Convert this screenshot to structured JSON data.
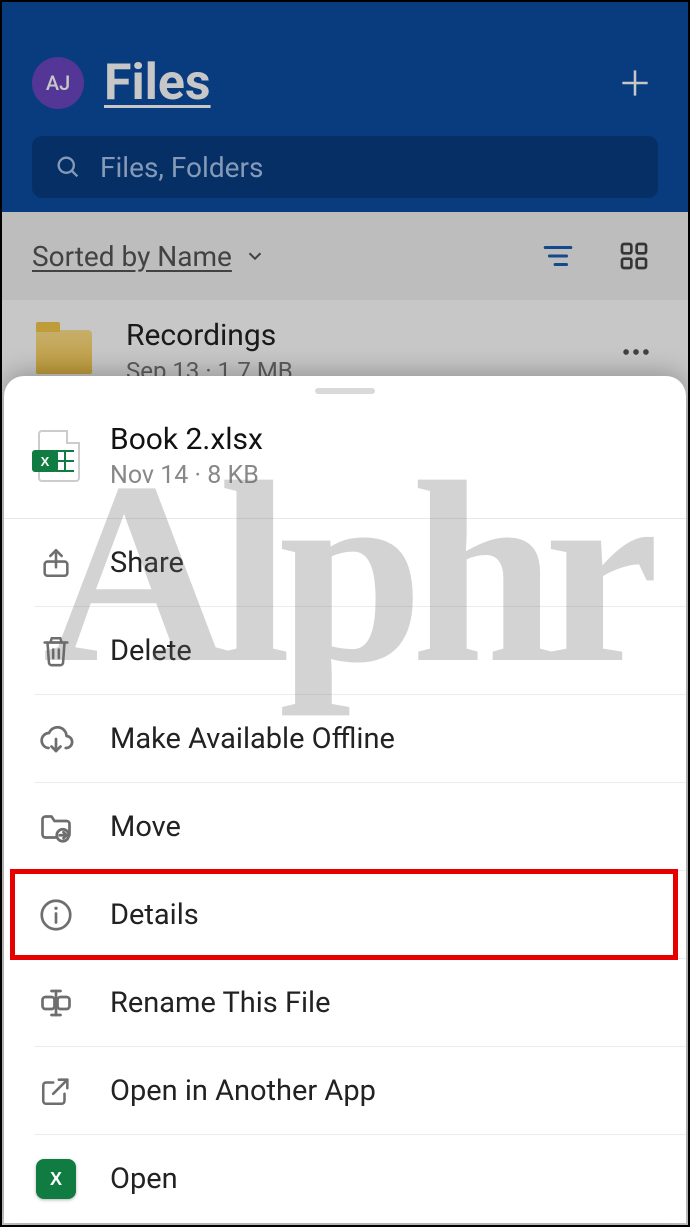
{
  "header": {
    "avatar_initials": "AJ",
    "title": "Files"
  },
  "search": {
    "placeholder": "Files, Folders"
  },
  "sort": {
    "label": "Sorted by Name"
  },
  "list": {
    "items": [
      {
        "name": "Recordings",
        "meta": "Sep 13 · 1.7 MB"
      }
    ]
  },
  "sheet": {
    "file_name": "Book 2.xlsx",
    "file_meta": "Nov 14 · 8 KB",
    "menu": [
      {
        "icon": "share-icon",
        "label": "Share"
      },
      {
        "icon": "trash-icon",
        "label": "Delete"
      },
      {
        "icon": "cloud-download-icon",
        "label": "Make Available Offline"
      },
      {
        "icon": "folder-move-icon",
        "label": "Move"
      },
      {
        "icon": "info-icon",
        "label": "Details",
        "highlight": true
      },
      {
        "icon": "rename-icon",
        "label": "Rename This File"
      },
      {
        "icon": "open-external-icon",
        "label": "Open in Another App"
      },
      {
        "icon": "excel-app-icon",
        "label": "Open"
      }
    ]
  },
  "watermark": "Alphr"
}
